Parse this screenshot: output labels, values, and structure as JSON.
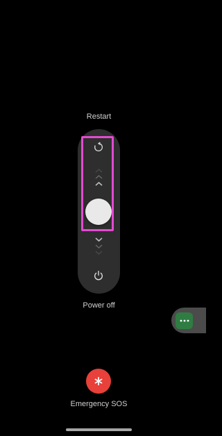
{
  "power_menu": {
    "restart_label": "Restart",
    "poweroff_label": "Power off",
    "emergency_label": "Emergency SOS"
  },
  "icons": {
    "restart": "restart-icon",
    "power": "power-icon",
    "chevron_up": "chevron-up-icon",
    "chevron_down": "chevron-down-icon",
    "emergency": "asterisk-icon",
    "bubble": "more-dots-icon"
  },
  "colors": {
    "background": "#000000",
    "track": "#2e2e2e",
    "thumb": "#e9e9e9",
    "highlight": "#e24bd0",
    "sos": "#e8403a",
    "bubble_accent": "#2f7d42"
  }
}
